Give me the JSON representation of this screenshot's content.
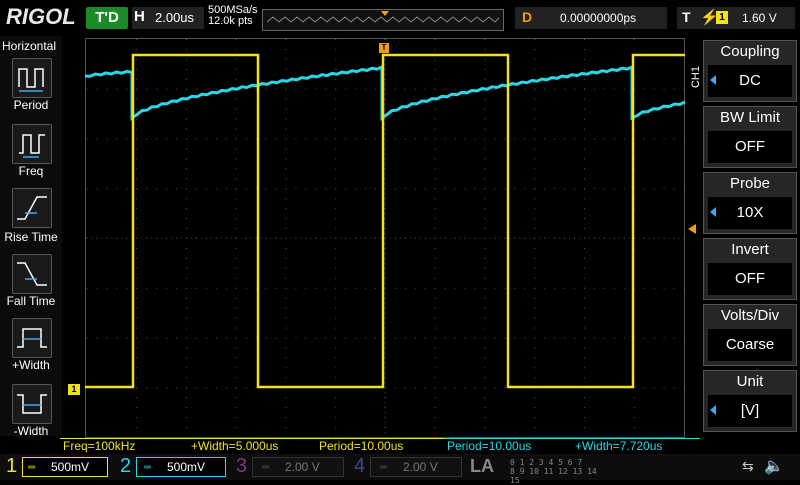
{
  "top": {
    "logo": "RIGOL",
    "trigger_status": "T'D",
    "horizontal_label": "H",
    "timebase": "2.00us",
    "sample_rate": "500MSa/s",
    "memory_depth": "12.0k pts",
    "delay_label": "D",
    "delay_value": "0.00000000ps",
    "trigger_label": "T",
    "trigger_source": "1",
    "trigger_level": "1.60 V"
  },
  "left_menu": {
    "title": "Horizontal",
    "items": [
      {
        "label": "Period",
        "icon": "period-icon"
      },
      {
        "label": "Freq",
        "icon": "freq-icon"
      },
      {
        "label": "Rise Time",
        "icon": "rise-time-icon"
      },
      {
        "label": "Fall Time",
        "icon": "fall-time-icon"
      },
      {
        "label": "+Width",
        "icon": "pos-width-icon"
      },
      {
        "label": "-Width",
        "icon": "neg-width-icon"
      }
    ]
  },
  "right_menu": {
    "channel_tag": "CH1",
    "items": [
      {
        "title": "Coupling",
        "value": "DC"
      },
      {
        "title": "BW Limit",
        "value": "OFF"
      },
      {
        "title": "Probe",
        "value": "10X"
      },
      {
        "title": "Invert",
        "value": "OFF"
      },
      {
        "title": "Volts/Div",
        "value": "Coarse"
      },
      {
        "title": "Unit",
        "value": "[V]"
      }
    ]
  },
  "measurements": [
    {
      "text": "Freq=100kHz",
      "color": "#f3e21b"
    },
    {
      "text": "+Width=5.000us",
      "color": "#f3e21b"
    },
    {
      "text": "Period=10.00us",
      "color": "#f3e21b"
    },
    {
      "text": "Period=10.00us",
      "color": "#27d8e6"
    },
    {
      "text": "+Width=7.720us",
      "color": "#27d8e6"
    }
  ],
  "channels": [
    {
      "num": "1",
      "scale": "500mV",
      "color": "#f3e21b",
      "active": true
    },
    {
      "num": "2",
      "scale": "500mV",
      "color": "#27d8e6",
      "active": true
    },
    {
      "num": "3",
      "scale": "2.00 V",
      "color": "#c050c0",
      "active": false
    },
    {
      "num": "4",
      "scale": "2.00 V",
      "color": "#4a6cd4",
      "active": false
    }
  ],
  "la_label": "LA",
  "digital_rows": [
    "0 1 2 3  4 5 6 7",
    "8 9 10 11 12 13 14 15"
  ],
  "markers": {
    "ch1_ground": "1",
    "trigger_pos": "T"
  },
  "colors": {
    "ch1": "#f3e21b",
    "ch2": "#27d8e6",
    "trigger": "#f39c12",
    "accent": "#3fa9f5"
  }
}
